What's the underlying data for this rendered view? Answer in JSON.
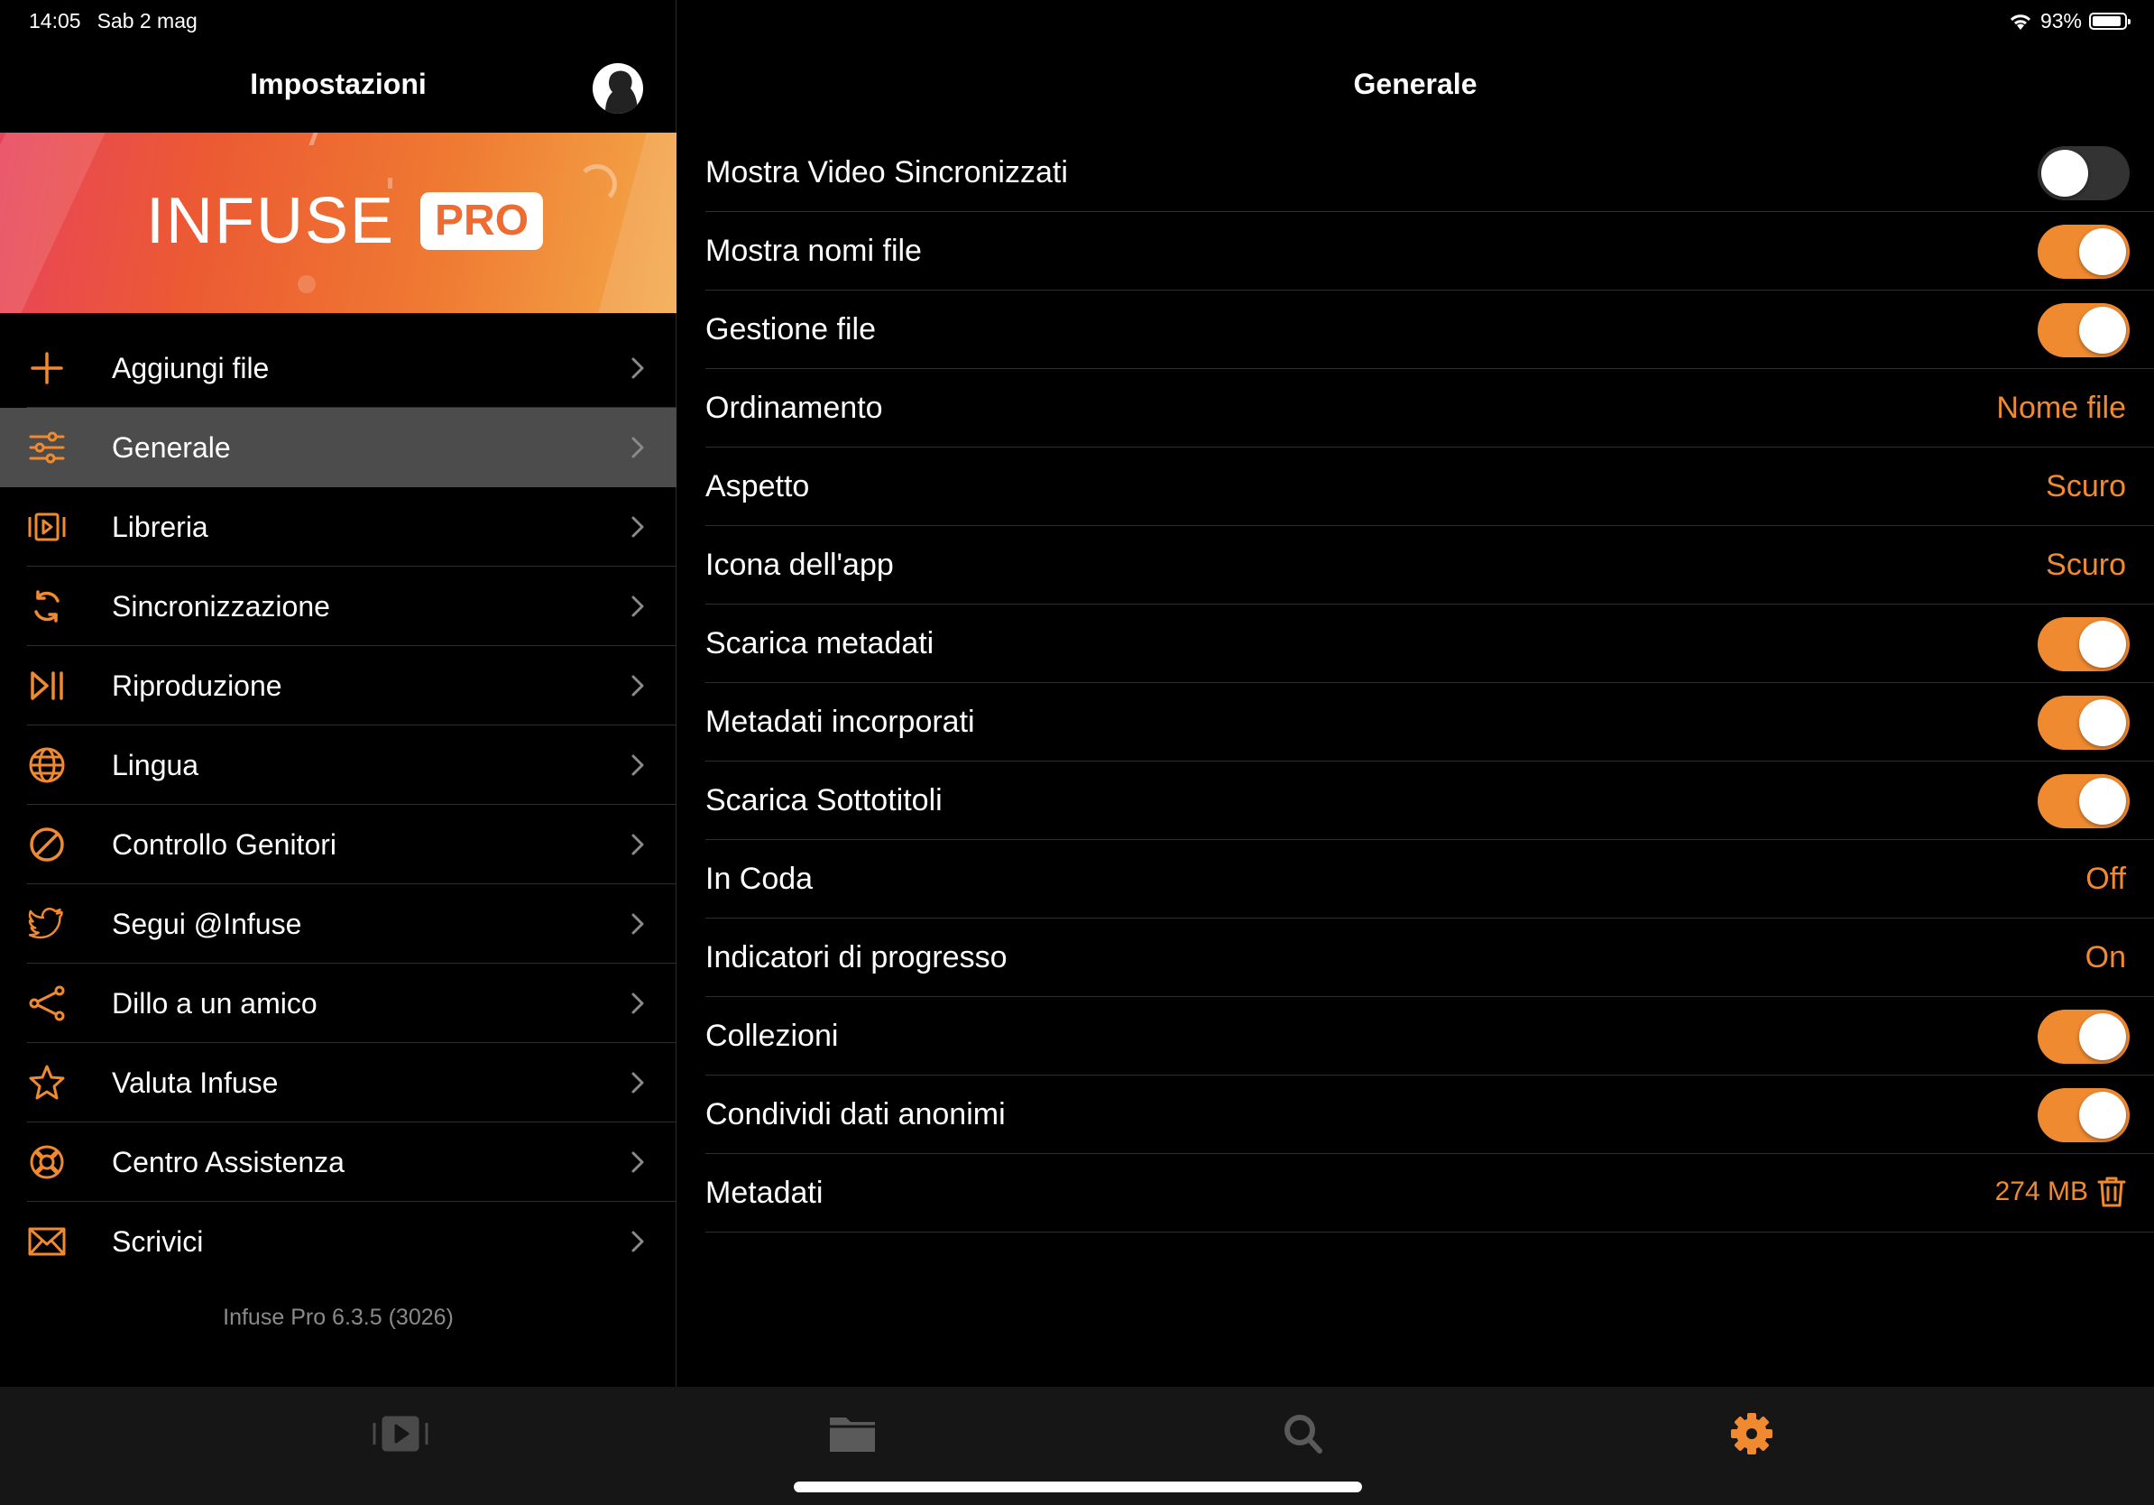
{
  "status_bar": {
    "time": "14:05",
    "date": "Sab 2 mag",
    "battery": "93%"
  },
  "sidebar": {
    "title": "Impostazioni",
    "banner": {
      "brand": "INFUSE",
      "badge": "PRO"
    },
    "items": [
      {
        "label": "Aggiungi file",
        "icon": "plus-icon"
      },
      {
        "label": "Generale",
        "icon": "sliders-icon",
        "selected": true
      },
      {
        "label": "Libreria",
        "icon": "library-icon"
      },
      {
        "label": "Sincronizzazione",
        "icon": "sync-icon"
      },
      {
        "label": "Riproduzione",
        "icon": "play-pause-icon"
      },
      {
        "label": "Lingua",
        "icon": "globe-icon"
      },
      {
        "label": "Controllo Genitori",
        "icon": "prohibited-icon"
      },
      {
        "label": "Segui @Infuse",
        "icon": "twitter-bird-icon"
      },
      {
        "label": "Dillo a un amico",
        "icon": "share-icon"
      },
      {
        "label": "Valuta Infuse",
        "icon": "star-icon"
      },
      {
        "label": "Centro Assistenza",
        "icon": "lifebuoy-icon"
      },
      {
        "label": "Scrivici",
        "icon": "mail-icon"
      }
    ],
    "version": "Infuse Pro 6.3.5 (3026)"
  },
  "detail": {
    "title": "Generale",
    "settings": [
      {
        "label": "Mostra Video Sincronizzati",
        "toggle": false
      },
      {
        "label": "Mostra nomi file",
        "toggle": true
      },
      {
        "label": "Gestione file",
        "toggle": true
      },
      {
        "label": "Ordinamento",
        "value": "Nome file"
      },
      {
        "label": "Aspetto",
        "value": "Scuro"
      },
      {
        "label": "Icona dell'app",
        "value": "Scuro"
      },
      {
        "label": "Scarica metadati",
        "toggle": true
      },
      {
        "label": "Metadati incorporati",
        "toggle": true
      },
      {
        "label": "Scarica Sottotitoli",
        "toggle": true
      },
      {
        "label": "In Coda",
        "value": "Off"
      },
      {
        "label": "Indicatori di progresso",
        "value": "On"
      },
      {
        "label": "Collezioni",
        "toggle": true
      },
      {
        "label": "Condividi dati anonimi",
        "toggle": true
      },
      {
        "label": "Metadati",
        "storage": "274 MB"
      }
    ]
  },
  "tabbar": [
    {
      "icon": "library-icon",
      "active": false
    },
    {
      "icon": "folder-icon",
      "active": false
    },
    {
      "icon": "search-icon",
      "active": false
    },
    {
      "icon": "gear-icon",
      "active": true
    }
  ],
  "colors": {
    "accent": "#f08a30",
    "background": "#000000",
    "selected_row": "#4c4c4c",
    "tabbar": "#161616"
  }
}
